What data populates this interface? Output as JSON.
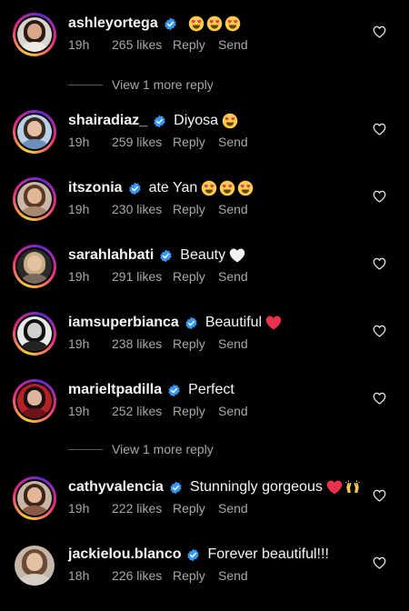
{
  "colors": {
    "background": "#000000",
    "text": "#f5f5f5",
    "meta_text": "#a8a8a8",
    "verified_badge": "#3897f0",
    "heart_red": "#ff3040"
  },
  "comments": [
    {
      "username": "ashleyortega",
      "verified": true,
      "text": "",
      "emojis": [
        "heart-eyes-emoji",
        "heart-eyes-emoji",
        "heart-eyes-emoji"
      ],
      "time": "19h",
      "likes": "265 likes",
      "reply_label": "Reply",
      "send_label": "Send",
      "avatar_ring": true,
      "avatar_colors": {
        "bg": "#d9d4cc",
        "hair": "#2a1c15",
        "face": "#d9a98a",
        "shoulders": "#efe9e2"
      }
    },
    {
      "username": "shairadiaz_",
      "verified": true,
      "text": "Diyosa",
      "emojis": [
        "heart-eyes-emoji"
      ],
      "time": "19h",
      "likes": "259 likes",
      "reply_label": "Reply",
      "send_label": "Send",
      "avatar_ring": true,
      "avatar_colors": {
        "bg": "#b9cfe6",
        "hair": "#3a2a20",
        "face": "#e6c0a4",
        "shoulders": "#6b8fbf"
      }
    },
    {
      "username": "itszonia",
      "verified": true,
      "text": "ate Yan",
      "emojis": [
        "heart-eyes-emoji",
        "heart-eyes-emoji",
        "heart-eyes-emoji"
      ],
      "time": "19h",
      "likes": "230 likes",
      "reply_label": "Reply",
      "send_label": "Send",
      "avatar_ring": true,
      "avatar_colors": {
        "bg": "#cbb8a8",
        "hair": "#5a3a25",
        "face": "#e1b896",
        "shoulders": "#a88770"
      }
    },
    {
      "username": "sarahlahbati",
      "verified": true,
      "text": "Beauty",
      "emojis": [
        "white-heart-emoji"
      ],
      "time": "19h",
      "likes": "291 likes",
      "reply_label": "Reply",
      "send_label": "Send",
      "avatar_ring": true,
      "avatar_colors": {
        "bg": "#2b2a2a",
        "hair": "#c7ad86",
        "face": "#e4c2a2",
        "shoulders": "#7b6a5c"
      }
    },
    {
      "username": "iamsuperbianca",
      "verified": true,
      "text": "Beautiful",
      "emojis": [
        "red-heart-emoji"
      ],
      "time": "19h",
      "likes": "238 likes",
      "reply_label": "Reply",
      "send_label": "Send",
      "avatar_ring": true,
      "avatar_colors": {
        "bg": "#e8e8e8",
        "hair": "#111111",
        "face": "#cfcfcf",
        "shoulders": "#222222"
      }
    },
    {
      "username": "marieltpadilla",
      "verified": true,
      "text": "Perfect",
      "emojis": [],
      "time": "19h",
      "likes": "252 likes",
      "reply_label": "Reply",
      "send_label": "Send",
      "avatar_ring": true,
      "avatar_colors": {
        "bg": "#b32028",
        "hair": "#1a1010",
        "face": "#e0b49a",
        "shoulders": "#6d1217"
      }
    },
    {
      "username": "cathyvalencia",
      "verified": true,
      "text": "Stunningly gorgeous",
      "emojis": [
        "red-heart-emoji",
        "raising-hands-emoji"
      ],
      "time": "19h",
      "likes": "222 likes",
      "reply_label": "Reply",
      "send_label": "Send",
      "avatar_ring": true,
      "avatar_colors": {
        "bg": "#c9b6a7",
        "hair": "#3b2418",
        "face": "#e3b797",
        "shoulders": "#8a5a44"
      }
    },
    {
      "username": "jackielou.blanco",
      "verified": true,
      "text": "Forever beautiful!!!",
      "emojis": [],
      "time": "18h",
      "likes": "226 likes",
      "reply_label": "Reply",
      "send_label": "Send",
      "avatar_ring": false,
      "avatar_colors": {
        "bg": "#c4b7a8",
        "hair": "#6a4a34",
        "face": "#e2c0a2",
        "shoulders": "#d8cfc4"
      }
    }
  ],
  "view_more": [
    {
      "label": "View 1 more reply"
    },
    {
      "label": "View 1 more reply"
    }
  ],
  "icons": {
    "like": "heart-outline-icon",
    "verified": "verified-badge-icon"
  }
}
